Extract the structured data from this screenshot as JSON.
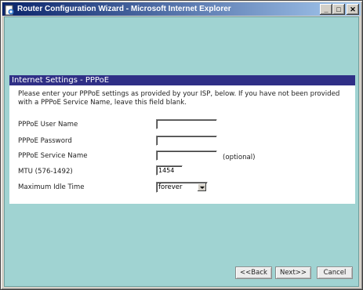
{
  "window": {
    "title": "Router Configuration Wizard - Microsoft Internet Explorer",
    "minimize_glyph": "_",
    "maximize_glyph": "□",
    "close_glyph": "✕"
  },
  "panel": {
    "title": "Internet Settings - PPPoE",
    "intro": "Please enter your PPPoE settings as provided by your ISP, below. If you have not been provided with a PPPoE Service Name, leave this field blank."
  },
  "form": {
    "user_name_label": "PPPoE User Name",
    "user_name_value": "",
    "password_label": "PPPoE Password",
    "password_value": "",
    "service_name_label": "PPPoE Service Name",
    "service_name_value": "",
    "service_name_note": "(optional)",
    "mtu_label": "MTU (576-1492)",
    "mtu_value": "1454",
    "idle_label": "Maximum Idle Time",
    "idle_value": "forever"
  },
  "buttons": {
    "back": "<<Back",
    "next": "Next>>",
    "cancel": "Cancel"
  },
  "colors": {
    "title_bar": "#0a246a",
    "page_background": "#a0d3d2",
    "panel_header": "#2f2f86"
  },
  "icons": {
    "app_icon": "ie-document-icon"
  }
}
